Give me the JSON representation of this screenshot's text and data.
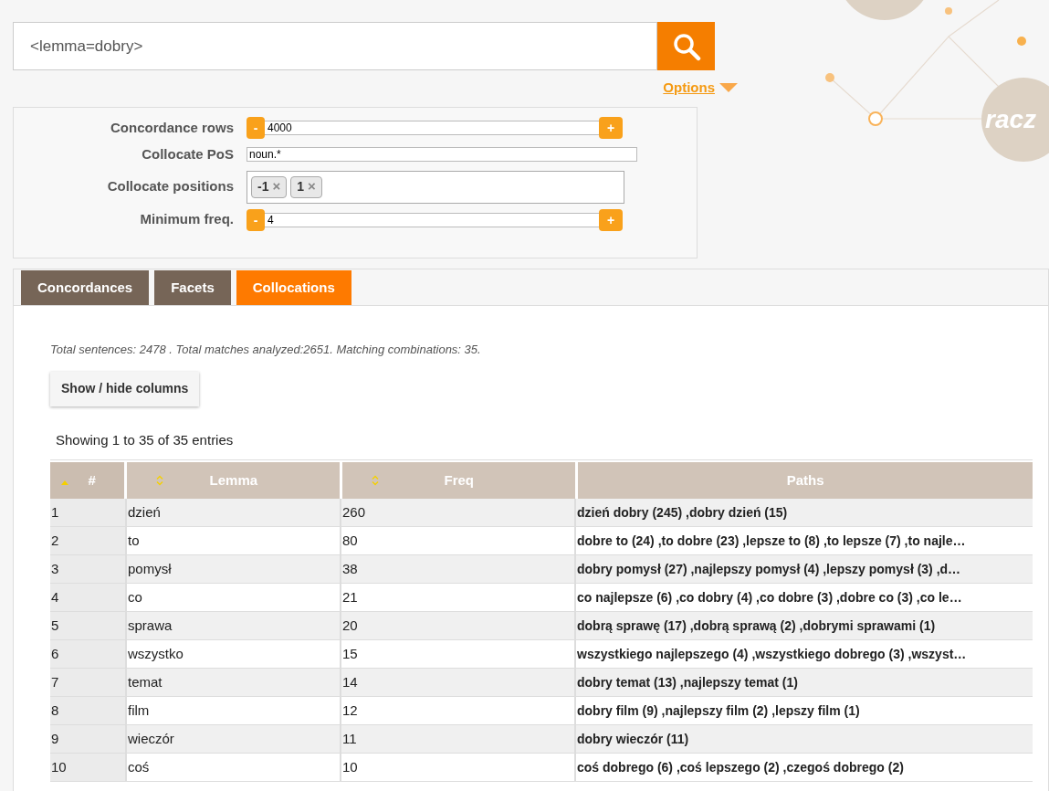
{
  "search": {
    "value": "<lemma=dobry>"
  },
  "options_link": {
    "label": "Options",
    "expanded": false
  },
  "logo": {
    "text": "racz"
  },
  "options": [
    {
      "kind": "stepper",
      "label": "Concordance rows",
      "value": "4000",
      "minus": "-",
      "plus": "+"
    },
    {
      "kind": "text",
      "label": "Collocate PoS",
      "value": "noun.*"
    },
    {
      "kind": "tags",
      "label": "Collocate positions",
      "tags": [
        {
          "text": "-1",
          "remove": "×"
        },
        {
          "text": "1",
          "remove": "×"
        }
      ]
    },
    {
      "kind": "stepper",
      "label": "Minimum freq.",
      "value": "4",
      "minus": "-",
      "plus": "+"
    }
  ],
  "tabs": [
    {
      "label": "Concordances",
      "selected": false
    },
    {
      "label": "Facets",
      "selected": false
    },
    {
      "label": "Collocations",
      "selected": true
    }
  ],
  "summary": "Total sentences: 2478 . Total matches analyzed:2651. Matching combinations: 35.",
  "columns_button": "Show / hide columns",
  "table_info": "Showing 1 to 35 of 35 entries",
  "table": {
    "columns": [
      {
        "label": "#",
        "sortable": true,
        "sorted": true
      },
      {
        "label": "Lemma",
        "sortable": true,
        "sorted": false
      },
      {
        "label": "Freq",
        "sortable": true,
        "sorted": false
      },
      {
        "label": "Paths",
        "sortable": false
      }
    ],
    "rows": [
      [
        "1",
        "dzień",
        "260",
        "dzień dobry (245) ,dobry dzień (15)"
      ],
      [
        "2",
        "to",
        "80",
        "dobre to (24) ,to dobre (23) ,lepsze to (8) ,to lepsze (7) ,to najle…"
      ],
      [
        "3",
        "pomysł",
        "38",
        "dobry pomysł (27) ,najlepszy pomysł (4) ,lepszy pomysł (3) ,d…"
      ],
      [
        "4",
        "co",
        "21",
        "co najlepsze (6) ,co dobry (4) ,co dobre (3) ,dobre co (3) ,co le…"
      ],
      [
        "5",
        "sprawa",
        "20",
        "dobrą sprawę (17) ,dobrą sprawą (2) ,dobrymi sprawami (1)"
      ],
      [
        "6",
        "wszystko",
        "15",
        "wszystkiego najlepszego (4) ,wszystkiego dobrego (3) ,wszyst…"
      ],
      [
        "7",
        "temat",
        "14",
        "dobry temat (13) ,najlepszy temat (1)"
      ],
      [
        "8",
        "film",
        "12",
        "dobry film (9) ,najlepszy film (2) ,lepszy film (1)"
      ],
      [
        "9",
        "wieczór",
        "11",
        "dobry wieczór (11)"
      ],
      [
        "10",
        "coś",
        "10",
        "coś dobrego (6) ,coś lepszego (2) ,czegoś dobrego (2)"
      ]
    ]
  }
}
